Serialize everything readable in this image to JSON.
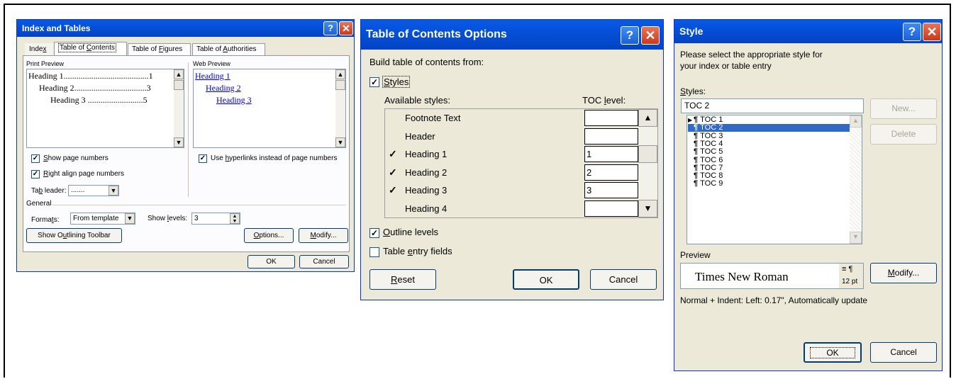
{
  "index_tables": {
    "title": "Index and Tables",
    "tabs": [
      {
        "label": "Index",
        "ukey": "x"
      },
      {
        "label": "Table of Contents",
        "ukey": "C"
      },
      {
        "label": "Table of Figures",
        "ukey": "F"
      },
      {
        "label": "Table of Authorities",
        "ukey": "A"
      }
    ],
    "print_preview_label": "Print Preview",
    "web_preview_label": "Web Preview",
    "print_lines": [
      "Heading 1........................................1",
      "Heading 2..................................3",
      "Heading 3 ..........................5"
    ],
    "web_lines": [
      "Heading 1",
      "Heading 2",
      "Heading 3"
    ],
    "show_page_numbers": "Show page numbers",
    "right_align": "Right align page numbers",
    "use_hyperlinks": "Use hyperlinks instead of page numbers",
    "tab_leader_label": "Tab leader:",
    "tab_leader_value": ".......",
    "general_label": "General",
    "formats_label": "Formats:",
    "formats_value": "From template",
    "show_levels_label": "Show levels:",
    "show_levels_value": "3",
    "outlining_button": "Show Outlining Toolbar",
    "options_button": "Options...",
    "modify_button": "Modify...",
    "ok": "OK",
    "cancel": "Cancel"
  },
  "toc_options": {
    "title": "Table of Contents Options",
    "build_label": "Build table of contents from:",
    "styles_check": "Styles",
    "available_label": "Available styles:",
    "level_label": "TOC level:",
    "rows": [
      {
        "name": "Footnote Text",
        "checked": false,
        "level": ""
      },
      {
        "name": "Header",
        "checked": false,
        "level": ""
      },
      {
        "name": "Heading 1",
        "checked": true,
        "level": "1"
      },
      {
        "name": "Heading 2",
        "checked": true,
        "level": "2"
      },
      {
        "name": "Heading 3",
        "checked": true,
        "level": "3"
      },
      {
        "name": "Heading 4",
        "checked": false,
        "level": ""
      }
    ],
    "outline_levels": "Outline levels",
    "table_entry_fields": "Table entry fields",
    "reset": "Reset",
    "ok": "OK",
    "cancel": "Cancel"
  },
  "style_dialog": {
    "title": "Style",
    "instruction_line1": "Please select the appropriate style for",
    "instruction_line2": "your index or table entry",
    "styles_label": "Styles:",
    "styles_value": "TOC 2",
    "items": [
      "TOC 1",
      "TOC 2",
      "TOC 3",
      "TOC 4",
      "TOC 5",
      "TOC 6",
      "TOC 7",
      "TOC 8",
      "TOC 9"
    ],
    "selected": "TOC 2",
    "new_button": "New...",
    "delete_button": "Delete",
    "preview_label": "Preview",
    "preview_font": "Times New Roman",
    "preview_size": "12 pt",
    "modify_button": "Modify...",
    "description": "Normal + Indent: Left:  0.17\", Automatically update",
    "ok": "OK",
    "cancel": "Cancel"
  }
}
